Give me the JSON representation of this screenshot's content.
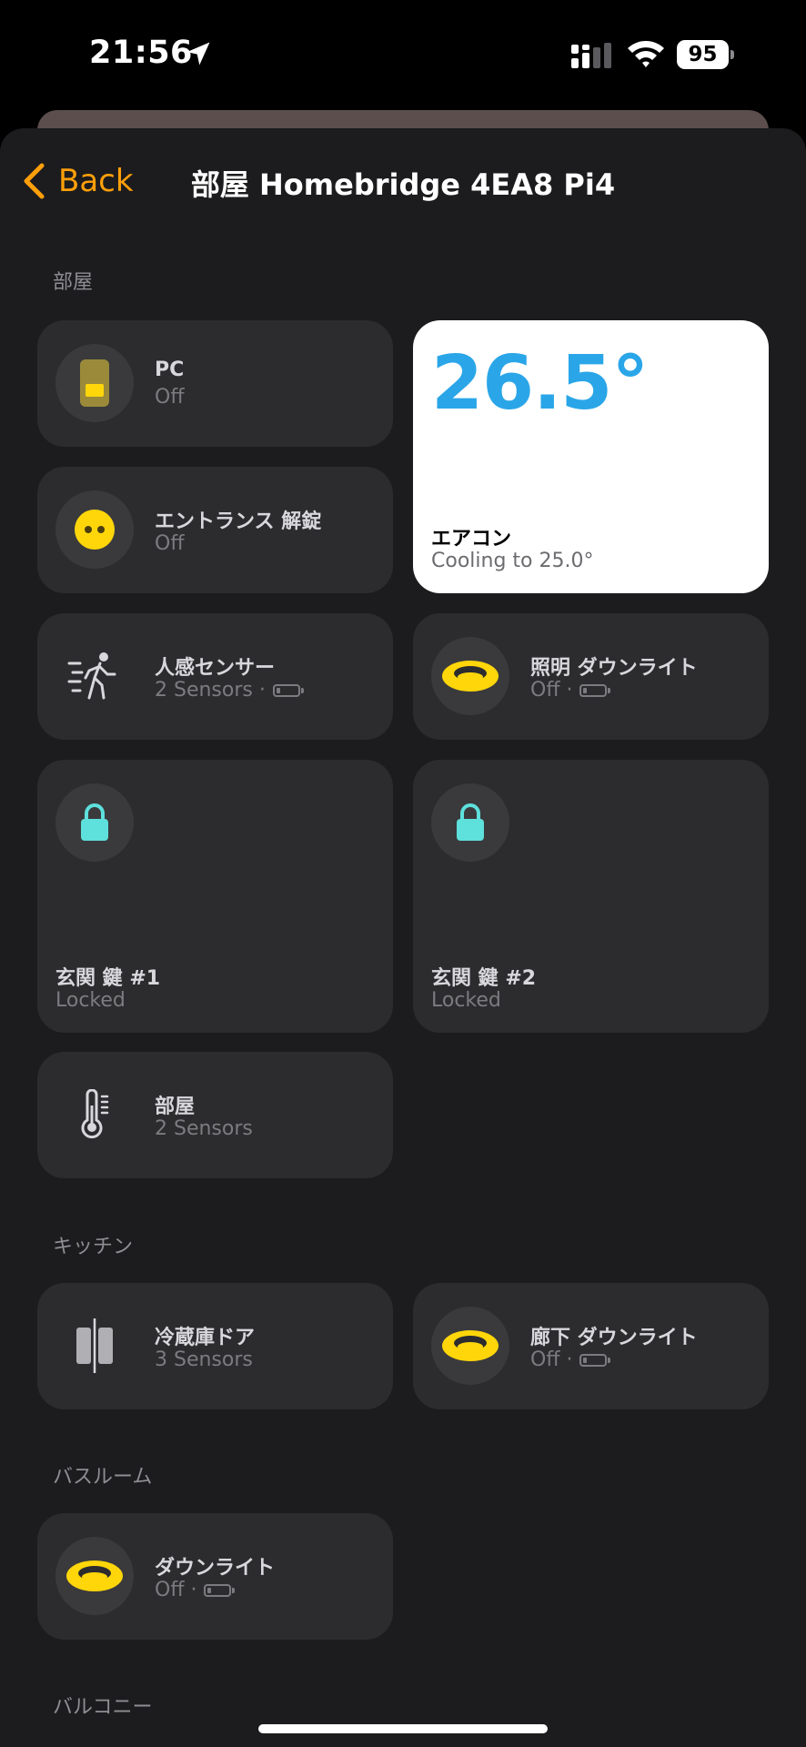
{
  "status_bar": {
    "time": "21:56",
    "battery": "95"
  },
  "nav": {
    "back_label": "Back",
    "title": "部屋 Homebridge 4EA8 Pi4"
  },
  "sections": {
    "room": "部屋",
    "kitchen": "キッチン",
    "bathroom": "バスルーム",
    "balcony": "バルコニー"
  },
  "tiles": {
    "pc": {
      "name": "PC",
      "status": "Off"
    },
    "entrance": {
      "name": "エントランス 解錠",
      "status": "Off"
    },
    "aircon": {
      "temp": "26.5°",
      "name": "エアコン",
      "status": "Cooling to 25.0°"
    },
    "motion": {
      "name": "人感センサー",
      "status": "2 Sensors ·"
    },
    "light": {
      "name": "照明 ダウンライト",
      "status": "Off ·"
    },
    "lock1": {
      "name": "玄関 鍵 #1",
      "status": "Locked"
    },
    "lock2": {
      "name": "玄関 鍵 #2",
      "status": "Locked"
    },
    "room_sensor": {
      "name": "部屋",
      "status": "2 Sensors"
    },
    "fridge": {
      "name": "冷蔵庫ドア",
      "status": "3 Sensors"
    },
    "hall_light": {
      "name": "廊下 ダウンライト",
      "status": "Off ·"
    },
    "bath_light": {
      "name": "ダウンライト",
      "status": "Off ·"
    }
  },
  "colors": {
    "accent": "#ff9f0a",
    "temp": "#2aa6e8",
    "light_on_yellow": "#ffd60a",
    "lock_cyan": "#5ee0dc"
  }
}
